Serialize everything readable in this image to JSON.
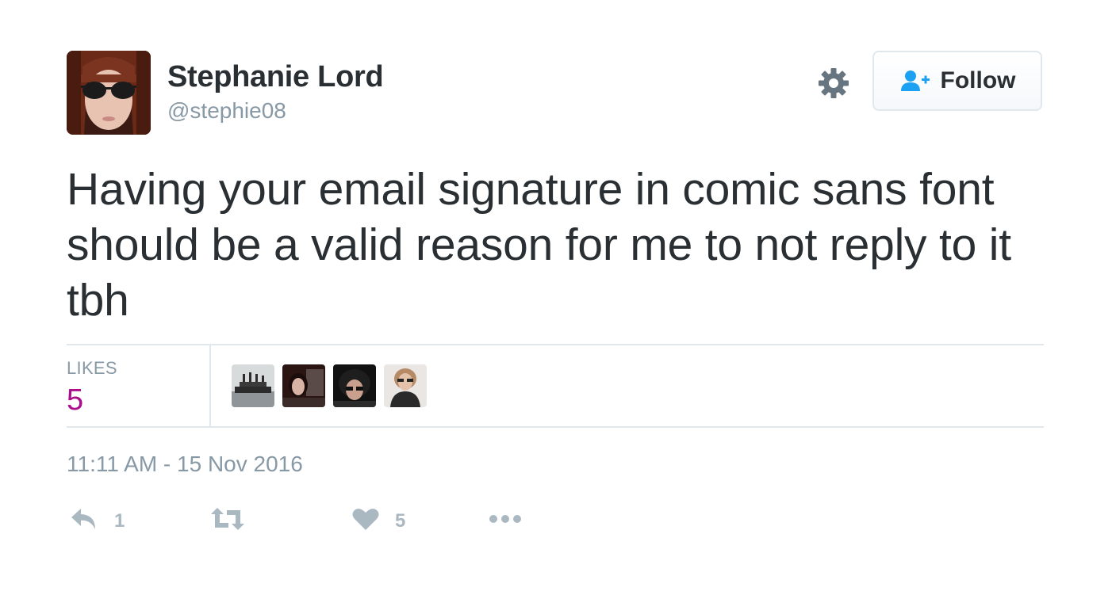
{
  "tweet": {
    "user": {
      "display_name": "Stephanie Lord",
      "screen_name": "@stephie08"
    },
    "follow_label": "Follow",
    "text": "Having your email signature in comic sans font should be a valid reason for me to not reply to it tbh",
    "stats": {
      "likes_label": "LIKES",
      "likes_count": "5"
    },
    "timestamp": "11:11 AM - 15 Nov 2016",
    "actions": {
      "reply_count": "1",
      "like_count": "5"
    }
  },
  "colors": {
    "text": "#292f33",
    "secondary": "#8899a6",
    "likes_accent": "#ab0d8b",
    "follow_icon": "#1da1f2",
    "action_icon": "#aab8c2",
    "border": "#e1e8ed"
  },
  "icons": [
    "gear-icon",
    "follow-person-icon",
    "reply-icon",
    "retweet-icon",
    "heart-icon",
    "more-icon"
  ]
}
